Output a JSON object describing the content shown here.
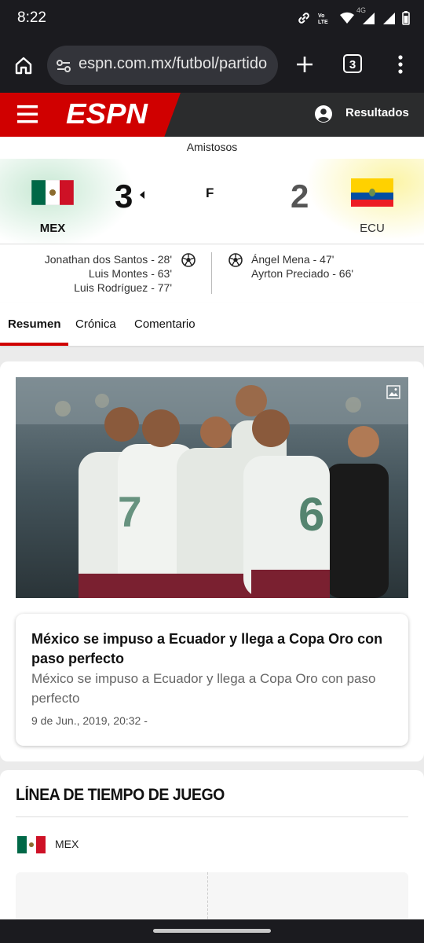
{
  "status_bar": {
    "time": "8:22",
    "icons": [
      "link-icon",
      "volte-icon",
      "wifi-icon",
      "signal-4g-icon",
      "signal-icon",
      "battery-icon"
    ],
    "lte_label": "4G"
  },
  "browser": {
    "url": "espn.com.mx/futbol/partido",
    "tab_count": "3"
  },
  "espn_header": {
    "logo": "ESPN",
    "results_label": "Resultados",
    "brand_color": "#d00000"
  },
  "match": {
    "competition": "Amistosos",
    "status": "F",
    "home": {
      "abbr": "MEX",
      "score": "3",
      "winner": true,
      "scorers": [
        "Jonathan dos Santos - 28'",
        "Luis Montes - 63'",
        "Luis Rodríguez - 77'"
      ]
    },
    "away": {
      "abbr": "ECU",
      "score": "2",
      "scorers": [
        "Ángel Mena - 47'",
        "Ayrton Preciado - 66'"
      ]
    }
  },
  "tabs": [
    {
      "label": "Resumen",
      "active": true
    },
    {
      "label": "Crónica",
      "active": false
    },
    {
      "label": "Comentario",
      "active": false
    }
  ],
  "article": {
    "title": "México se impuso a Ecuador y llega a Copa Oro con paso perfecto",
    "summary": "México se impuso a Ecuador y llega a Copa Oro con paso perfecto",
    "date": "9 de Jun., 2019, 20:32 -"
  },
  "timeline": {
    "title": "LÍNEA DE TIEMPO DE JUEGO",
    "team": "MEX"
  }
}
